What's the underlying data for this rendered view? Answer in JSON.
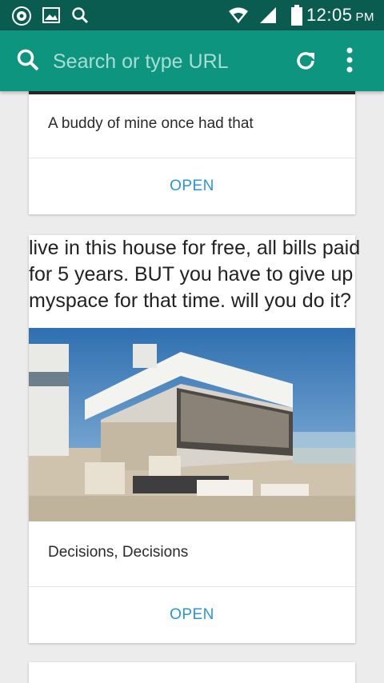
{
  "status_bar": {
    "time": "12:05",
    "ampm": "PM",
    "left_icons": [
      "record-icon",
      "image-icon",
      "search-icon"
    ],
    "right_icons": [
      "wifi-icon",
      "signal-icon",
      "battery-icon"
    ]
  },
  "toolbar": {
    "search_placeholder": "Search or type URL",
    "icons": [
      "search-icon",
      "reload-icon",
      "overflow-menu-icon"
    ],
    "color": "#0e9580"
  },
  "feed": {
    "cards": [
      {
        "caption": "A buddy of mine once had that",
        "open_label": "OPEN"
      },
      {
        "meme_lines": [
          "live in this house for free, all bills paid",
          "for 5 years. BUT you have to give up",
          "myspace for that time. will you do it?"
        ],
        "image": "modern-house-photo",
        "caption": "Decisions, Decisions",
        "open_label": "OPEN"
      }
    ]
  },
  "colors": {
    "status_bar": "#0a5c50",
    "toolbar": "#0e9580",
    "link": "#2b95d5",
    "background": "#ececec"
  }
}
